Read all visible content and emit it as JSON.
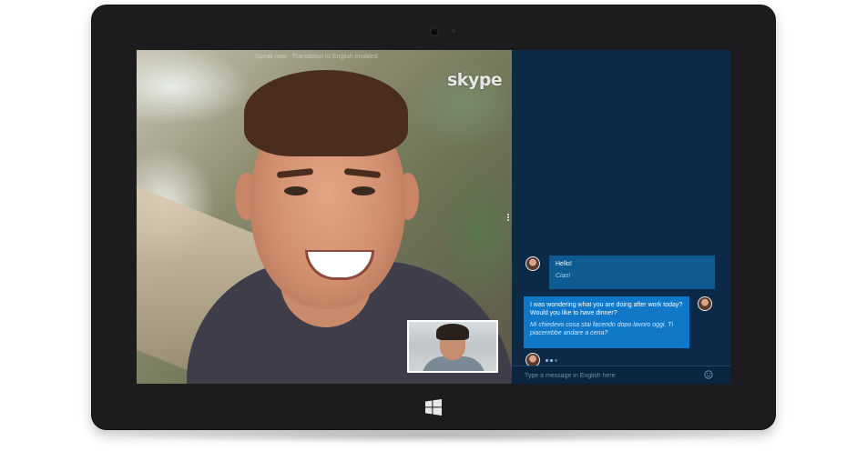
{
  "app": {
    "logo_text": "skype",
    "top_caption": "Speak now · Translation to English enabled"
  },
  "chat": {
    "messages": [
      {
        "direction": "incoming",
        "original": "Hello!",
        "translation": "Ciao!"
      },
      {
        "direction": "outgoing",
        "original": "I was wondering what you are doing after work today? Would you like to have dinner?",
        "translation": "Mi chiedevo cosa stai facendo dopo lavoro oggi. Ti piacerebbe andare a cena?"
      }
    ],
    "typing_indicator": "•••",
    "input_placeholder": "Type a message in English here"
  },
  "icons": {
    "emoji": "smiley-icon",
    "windows": "windows-logo-icon",
    "camera": "front-camera-icon"
  },
  "colors": {
    "chat_background": "#0c2a47",
    "incoming_bubble": "#0e5a93",
    "outgoing_bubble": "#0f78c8",
    "bezel": "#1c1c1e"
  }
}
